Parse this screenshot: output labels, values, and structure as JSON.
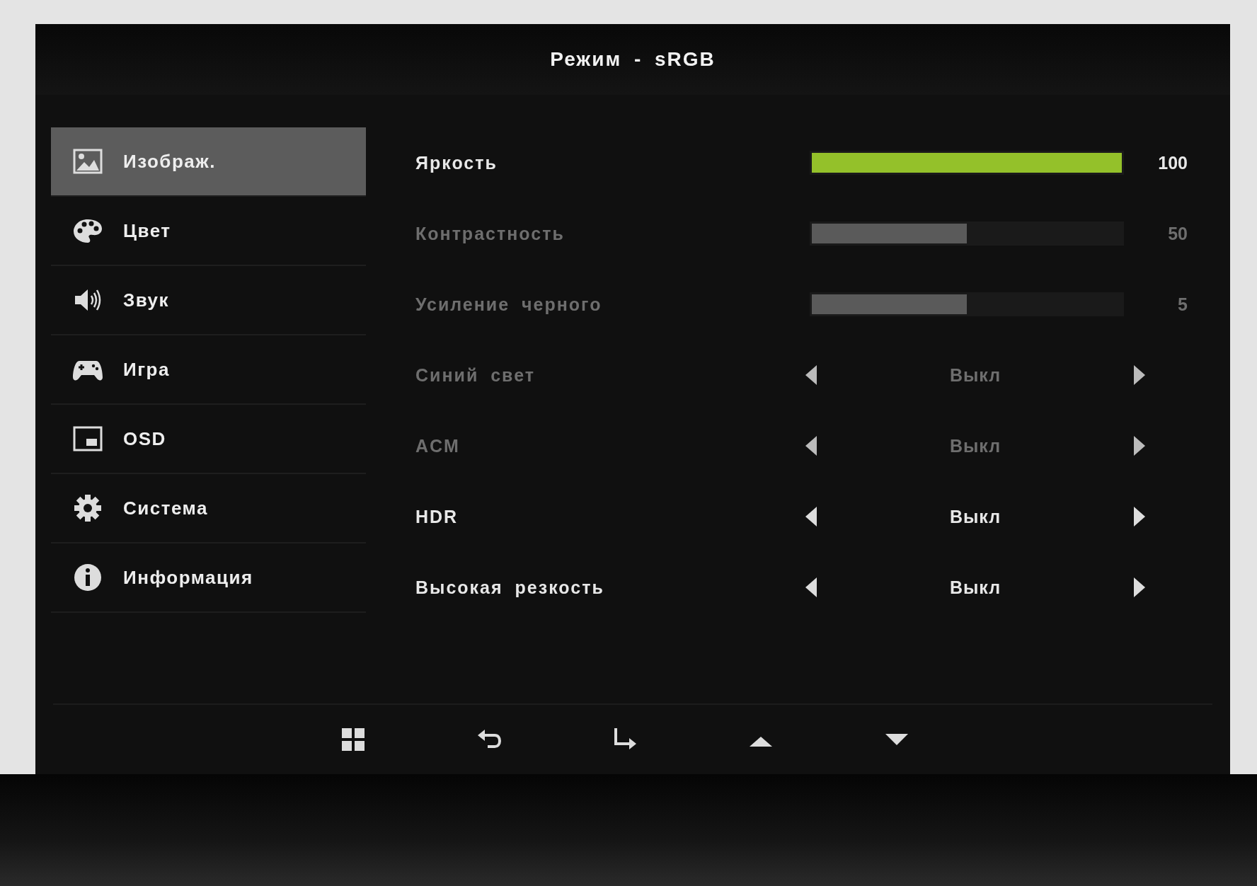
{
  "title": "Режим - sRGB",
  "menu": [
    {
      "label": "Изображ.",
      "selected": true
    },
    {
      "label": "Цвет",
      "selected": false
    },
    {
      "label": "Звук",
      "selected": false
    },
    {
      "label": "Игра",
      "selected": false
    },
    {
      "label": "OSD",
      "selected": false
    },
    {
      "label": "Система",
      "selected": false
    },
    {
      "label": "Информация",
      "selected": false
    }
  ],
  "settings": [
    {
      "kind": "slider",
      "label": "Яркость",
      "disabled": false,
      "level": 1,
      "value": "100"
    },
    {
      "kind": "slider",
      "label": "Контрастность",
      "disabled": true,
      "level": 0.5,
      "value": "50"
    },
    {
      "kind": "slider",
      "label": "Усиление черного",
      "disabled": true,
      "level": 0.5,
      "value": "5"
    },
    {
      "kind": "choice",
      "label": "Синий свет",
      "disabled": true,
      "value": "Выкл"
    },
    {
      "kind": "choice",
      "label": "ACM",
      "disabled": true,
      "value": "Выкл"
    },
    {
      "kind": "choice",
      "label": "HDR",
      "disabled": false,
      "value": "Выкл"
    },
    {
      "kind": "choice",
      "label": "Высокая резкость",
      "disabled": false,
      "value": "Выкл"
    }
  ]
}
